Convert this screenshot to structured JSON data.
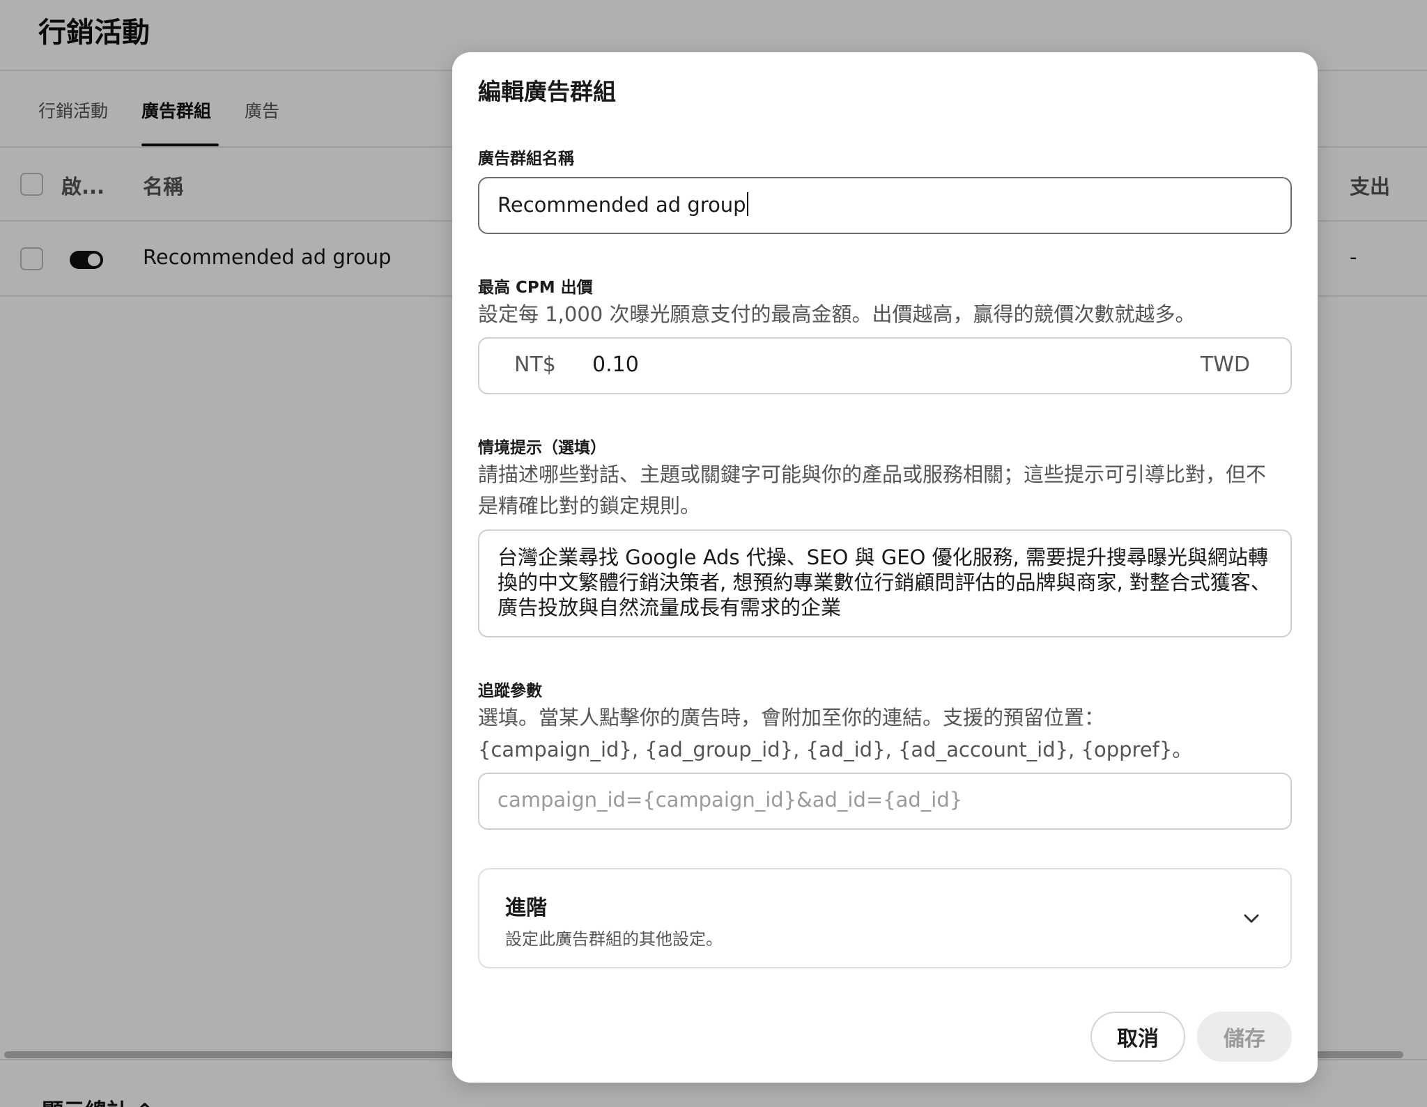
{
  "page": {
    "title": "行銷活動",
    "tabs": [
      {
        "label": "行銷活動",
        "active": false
      },
      {
        "label": "廣告群組",
        "active": true
      },
      {
        "label": "廣告",
        "active": false
      }
    ],
    "table": {
      "columns": {
        "enabled": "啟...",
        "name": "名稱",
        "spend": "支出"
      },
      "rows": [
        {
          "enabled": true,
          "name": "Recommended ad group",
          "spend": "-"
        }
      ]
    },
    "footer_label": "顯示總計 ⌃"
  },
  "dialog": {
    "title": "編輯廣告群組",
    "name_field": {
      "label": "廣告群組名稱",
      "value": "Recommended ad group"
    },
    "bid_field": {
      "label": "最高 CPM 出價",
      "help": "設定每 1,000 次曝光願意支付的最高金額。出價越高，贏得的競價次數就越多。",
      "prefix": "NT$",
      "value": "0.10",
      "suffix": "TWD"
    },
    "context_field": {
      "label": "情境提示（選填）",
      "help": "請描述哪些對話、主題或關鍵字可能與你的產品或服務相關；這些提示可引導比對，但不是精確比對的鎖定規則。",
      "value": "台灣企業尋找 Google Ads 代操、SEO 與 GEO 優化服務, 需要提升搜尋曝光與網站轉換的中文繁體行銷決策者, 想預約專業數位行銷顧問評估的品牌與商家, 對整合式獲客、廣告投放與自然流量成長有需求的企業"
    },
    "tracking_field": {
      "label": "追蹤參數",
      "help_line1": "選填。當某人點擊你的廣告時，會附加至你的連結。支援的預留位置：",
      "help_line2": "{campaign_id}, {ad_group_id}, {ad_id}, {ad_account_id}, {oppref}。",
      "placeholder": "campaign_id={campaign_id}&ad_id={ad_id}",
      "value": ""
    },
    "advanced": {
      "title": "進階",
      "description": "設定此廣告群組的其他設定。",
      "icon": "chevron-down-icon",
      "expanded": false
    },
    "buttons": {
      "cancel": "取消",
      "save": "儲存",
      "save_enabled": false
    }
  },
  "colors": {
    "overlay": "rgba(0,0,0,0.31)",
    "primary_text": "#1a1a1a",
    "secondary_text": "#555555",
    "toggle_on": "#111111",
    "disabled_button": "#ececec"
  }
}
